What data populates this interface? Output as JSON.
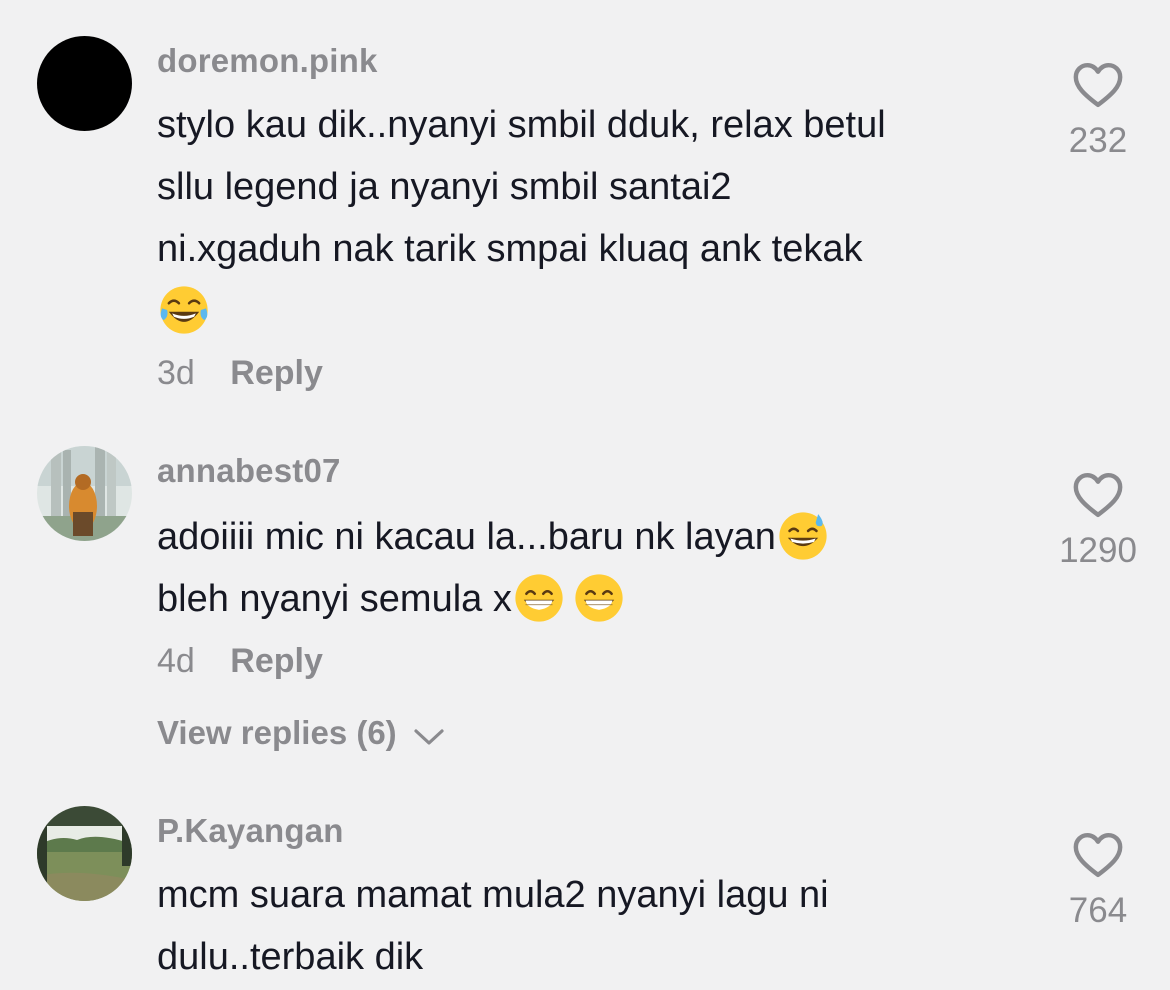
{
  "comments": [
    {
      "username": "doremon.pink",
      "lines": [
        "stylo kau dik..nyanyi smbil dduk, relax betul",
        "sllu legend ja nyanyi smbil santai2",
        "ni.xgaduh nak tarik smpai kluaq ank tekak"
      ],
      "emojis": [
        "face-with-tears-of-joy"
      ],
      "time": "3d",
      "reply_label": "Reply",
      "likes": "232",
      "avatar": "black-circle"
    },
    {
      "username": "annabest07",
      "lines": [
        "adoiiii mic ni kacau la...baru nk layan",
        "bleh nyanyi semula x"
      ],
      "emojis": [
        "grinning-face-with-sweat",
        "beaming-face",
        "beaming-face"
      ],
      "time": "4d",
      "reply_label": "Reply",
      "likes": "1290",
      "view_replies": "View replies (6)",
      "avatar": "photo-person-towers"
    },
    {
      "username": "P.Kayangan",
      "lines": [
        "mcm suara mamat mula2 nyanyi lagu ni",
        "dulu..terbaik dik"
      ],
      "likes": "764",
      "avatar": "photo-landscape-field"
    }
  ],
  "icons": {
    "like": "heart-outline-icon",
    "expand": "chevron-down-icon"
  },
  "colors": {
    "background": "#f1f1f2",
    "text_primary": "#161823",
    "text_secondary": "#8a8a8e"
  }
}
